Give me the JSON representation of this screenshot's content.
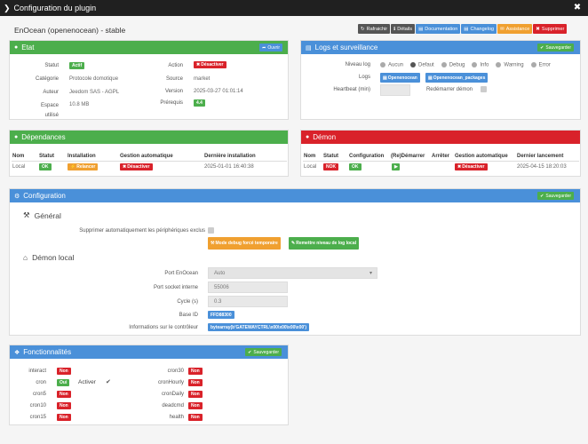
{
  "window": {
    "title": "Configuration du plugin"
  },
  "app": {
    "title": "EnOcean (openenocean) - stable"
  },
  "toolbar": [
    {
      "label": "Rafraichir",
      "icon": "refresh-icon",
      "color": "#555555"
    },
    {
      "label": "Détails",
      "icon": "info-icon",
      "color": "#555555"
    },
    {
      "label": "Documentation",
      "icon": "book-icon",
      "color": "#4a90d9"
    },
    {
      "label": "Changelog",
      "icon": "book-icon",
      "color": "#4a90d9"
    },
    {
      "label": "Assistance",
      "icon": "ticket-icon",
      "color": "#f0a030"
    },
    {
      "label": "Supprimer",
      "icon": "trash-icon",
      "color": "#d9222a"
    }
  ],
  "etat": {
    "header": "Etat",
    "open_label": "Ouvrir",
    "statut_label": "Statut",
    "statut_value": "Actif",
    "categorie_label": "Catégorie",
    "categorie_value": "Protocole domotique",
    "auteur_label": "Auteur",
    "auteur_value": "Jeedom SAS - AGPL",
    "espace_label": "Espace\nutilisé",
    "espace_value": "10.8 MB",
    "action_label": "Action",
    "action_value": "Désactiver",
    "source_label": "Source",
    "source_value": "market",
    "version_label": "Version",
    "version_value": "2025-03-27 01:01:14",
    "prerequis_label": "Prérequis",
    "prerequis_value": "4.4"
  },
  "logs": {
    "header": "Logs et surveillance",
    "save_label": "Sauvegarder",
    "niveau_label": "Niveau log",
    "levels": [
      "Aucun",
      "Defaut",
      "Debug",
      "Info",
      "Warning",
      "Error"
    ],
    "selected_level": "Defaut",
    "logs_label": "Logs",
    "log_buttons": [
      "Openenocean",
      "Openenocean_packages"
    ],
    "heartbeat_label": "Heartbeat (min)",
    "heartbeat_value": "",
    "restart_label": "Redémarrer démon"
  },
  "dependances": {
    "header": "Dépendances",
    "headers": [
      "Nom",
      "Statut",
      "Installation",
      "Gestion automatique",
      "Dernière installation"
    ],
    "row": {
      "nom": "Local",
      "statut": "OK",
      "installation": "Relancer",
      "gestion": "Désactiver",
      "derniere": "2025-01-01 16:40:38"
    }
  },
  "demon": {
    "header": "Démon",
    "headers": [
      "Nom",
      "Statut",
      "Configuration",
      "(Re)Démarrer",
      "Arrêter",
      "Gestion automatique",
      "Dernier lancement"
    ],
    "row": {
      "nom": "Local",
      "statut": "NOK",
      "configuration": "OK",
      "gestion": "Désactiver",
      "dernier": "2025-04-15 18:20:03"
    }
  },
  "configuration": {
    "header": "Configuration",
    "save_label": "Sauvegarder",
    "general_title": "Général",
    "supprimer_label": "Supprimer automatiquement les périphériques exclus",
    "debug_button": "Mode debug forcé temporaire",
    "reset_button": "Remettre niveau de log local",
    "demon_title": "Démon local",
    "port_label": "Port EnOcean",
    "port_value": "Auto",
    "socket_label": "Port socket interne",
    "socket_value": "55006",
    "cycle_label": "Cycle (s)",
    "cycle_value": "0.3",
    "baseid_label": "Base ID",
    "baseid_value": "FFD88300",
    "info_label": "Informations sur le contrôleur",
    "info_value": "bytearray(b'GATEWAYCTRL\\x00\\x00\\x00\\x00')"
  },
  "fonctionnalites": {
    "header": "Fonctionnalités",
    "save_label": "Sauvegarder",
    "activer_label": "Activer",
    "left": [
      {
        "name": "interact",
        "value": "Non"
      },
      {
        "name": "cron",
        "value": "Oui"
      },
      {
        "name": "cron5",
        "value": "Non"
      },
      {
        "name": "cron10",
        "value": "Non"
      },
      {
        "name": "cron15",
        "value": "Non"
      }
    ],
    "right": [
      {
        "name": "cron30",
        "value": "Non"
      },
      {
        "name": "cronHourly",
        "value": "Non"
      },
      {
        "name": "cronDaily",
        "value": "Non"
      },
      {
        "name": "deadcmd",
        "value": "Non"
      },
      {
        "name": "health",
        "value": "Non"
      }
    ]
  },
  "colors": {
    "green": "#4cae4c",
    "red": "#d9222a",
    "blue": "#4a90d9",
    "orange": "#f0a030",
    "titlebar": "#202020"
  }
}
